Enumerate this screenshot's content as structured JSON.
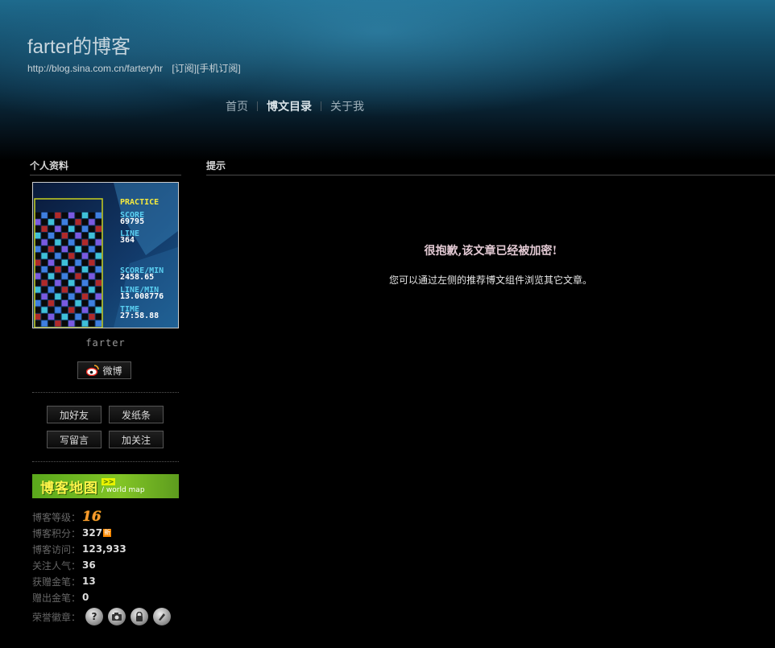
{
  "header": {
    "blog_title": "farter的博客",
    "blog_url": "http://blog.sina.com.cn/farteryhr",
    "subscribe": "[订阅]",
    "mobile_subscribe": "[手机订阅]"
  },
  "nav": {
    "items": [
      {
        "label": "首页",
        "active": false
      },
      {
        "label": "博文目录",
        "active": true
      },
      {
        "label": "关于我",
        "active": false
      }
    ]
  },
  "sidebar": {
    "section_title": "个人资料",
    "avatar_game": {
      "mode": "PRACTICE",
      "score_label": "SCORE",
      "score": "69795",
      "line_label": "LINE",
      "line": "364",
      "score_min_label": "SCORE/MIN",
      "score_min": "2458.65",
      "line_min_label": "LINE/MIN",
      "line_min": "13.008776",
      "time_label": "TIME",
      "time": "27:58.88"
    },
    "username": "farter",
    "weibo_button": "微博",
    "actions": {
      "add_friend": "加好友",
      "send_note": "发纸条",
      "write_message": "写留言",
      "follow": "加关注"
    },
    "world_map": {
      "title": "博客地图",
      "go": ">>",
      "subtitle": "/ world map"
    },
    "stats": {
      "level_label": "博客等级：",
      "level": "16",
      "points_label": "博客积分：",
      "points": "327",
      "points_badge": "新",
      "visits_label": "博客访问：",
      "visits": "123,933",
      "popularity_label": "关注人气：",
      "popularity": "36",
      "gold_received_label": "获赠金笔：",
      "gold_received": "13",
      "gold_given_label": "赠出金笔：",
      "gold_given": "0",
      "honor_label": "荣誉徽章："
    },
    "honor_badges": [
      "question-badge-icon",
      "camera-badge-icon",
      "lock-badge-icon",
      "pen-badge-icon"
    ]
  },
  "main": {
    "section_title": "提示",
    "notice_title": "很抱歉,该文章已经被加密!",
    "notice_body": "您可以通过左侧的推荐博文组件浏览其它文章。"
  },
  "colors": {
    "background": "#000000",
    "banner_top": "#1d6a8c",
    "level": "#ff9a2e",
    "world_map": "#82c526"
  }
}
